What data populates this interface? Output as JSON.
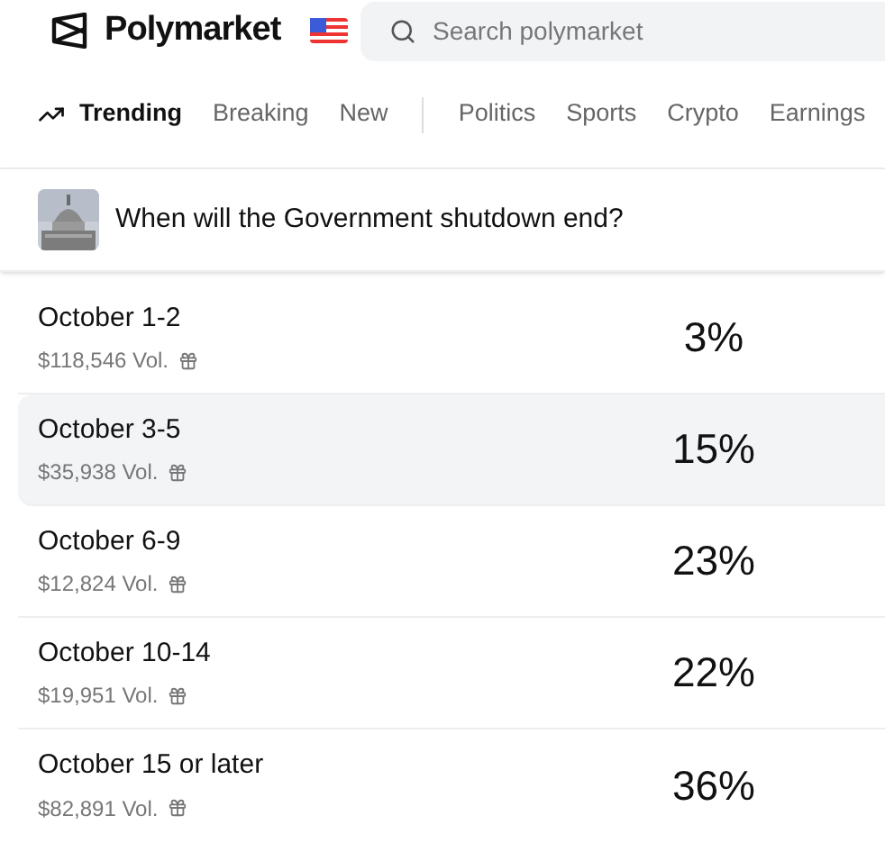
{
  "header": {
    "brand": "Polymarket",
    "search": {
      "placeholder": "Search polymarket"
    }
  },
  "nav": {
    "tabs": [
      {
        "label": "Trending",
        "selected": true,
        "kind": "trending"
      },
      {
        "label": "Breaking",
        "selected": false,
        "kind": "plain"
      },
      {
        "label": "New",
        "selected": false,
        "kind": "plain"
      },
      {
        "label": "Politics",
        "selected": false,
        "kind": "category"
      },
      {
        "label": "Sports",
        "selected": false,
        "kind": "category"
      },
      {
        "label": "Crypto",
        "selected": false,
        "kind": "category"
      },
      {
        "label": "Earnings",
        "selected": false,
        "kind": "category"
      }
    ]
  },
  "market": {
    "title": "When will the Government shutdown end?",
    "outcomes": [
      {
        "name": "October 1-2",
        "volume": "$118,546 Vol.",
        "chance": "3%",
        "selected": false
      },
      {
        "name": "October 3-5",
        "volume": "$35,938 Vol.",
        "chance": "15%",
        "selected": true
      },
      {
        "name": "October 6-9",
        "volume": "$12,824 Vol.",
        "chance": "23%",
        "selected": false
      },
      {
        "name": "October 10-14",
        "volume": "$19,951 Vol.",
        "chance": "22%",
        "selected": false
      },
      {
        "name": "October 15 or later",
        "volume": "$82,891 Vol.",
        "chance": "36%",
        "selected": false
      }
    ]
  }
}
